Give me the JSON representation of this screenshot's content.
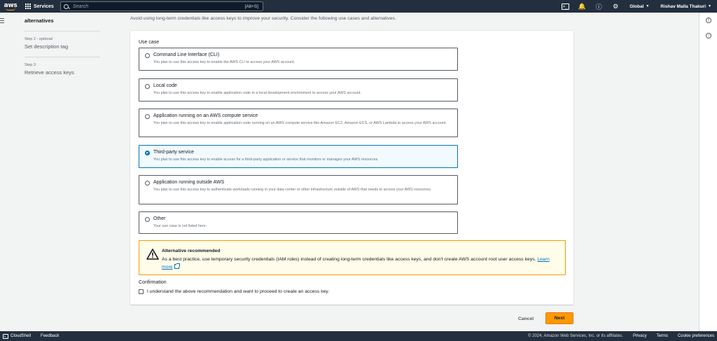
{
  "topnav": {
    "logo_text": "aws",
    "services_label": "Services",
    "search_placeholder": "Search",
    "search_shortcut": "[Alt+S]",
    "region_label": "Global",
    "user_label": "Rishav Malla Thakuri"
  },
  "steps": {
    "current_title": "alternatives",
    "items": [
      {
        "label": "Step 2",
        "optional": "optional",
        "name": "Set description tag"
      },
      {
        "label": "Step 3",
        "name": "Retrieve access keys"
      }
    ]
  },
  "intro": "Avoid using long-term credentials like access keys to improve your security. Consider the following use cases and alternatives.",
  "use_case": {
    "label": "Use case",
    "selected": 3,
    "options": [
      {
        "title": "Command Line Interface (CLI)",
        "desc": "You plan to use this access key to enable the AWS CLI to access your AWS account."
      },
      {
        "title": "Local code",
        "desc": "You plan to use this access key to enable application code in a local development environment to access your AWS account."
      },
      {
        "title": "Application running on an AWS compute service",
        "desc": "You plan to use this access key to enable application code running on an AWS compute service like Amazon EC2, Amazon ECS, or AWS Lambda to access your AWS account."
      },
      {
        "title": "Third-party service",
        "desc": "You plan to use this access key to enable access for a third-party application or service that monitors or manages your AWS resources."
      },
      {
        "title": "Application running outside AWS",
        "desc": "You plan to use this access key to authenticate workloads running in your data center or other infrastructure outside of AWS that needs to access your AWS resources."
      },
      {
        "title": "Other",
        "desc": "Your use case is not listed here."
      }
    ]
  },
  "alert": {
    "title": "Alternative recommended",
    "body": "As a best practice, use temporary security credentials (IAM roles) instead of creating long-term credentials like access keys, and don't create AWS account root user access keys.",
    "link": "Learn more"
  },
  "confirmation": {
    "label": "Confirmation",
    "checkbox_text": "I understand the above recommendation and want to proceed to create an access key.",
    "checked": false
  },
  "buttons": {
    "cancel": "Cancel",
    "next": "Next"
  },
  "footer": {
    "cloudshell": "CloudShell",
    "feedback": "Feedback",
    "copyright": "© 2024, Amazon Web Services, Inc. or its affiliates.",
    "privacy": "Privacy",
    "terms": "Terms",
    "cookies": "Cookie preferences"
  },
  "colors": {
    "nav_bg": "#232f3e",
    "accent_orange": "#ff9900",
    "link_blue": "#0073bb",
    "selected_bg": "#f1faff",
    "alert_bg": "#fffce9"
  }
}
